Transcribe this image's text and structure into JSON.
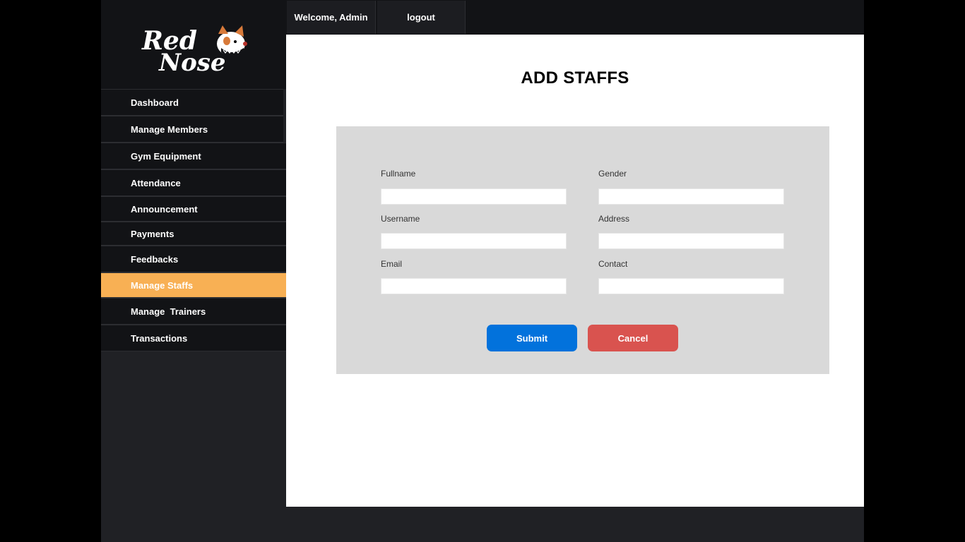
{
  "brand": {
    "logo_line1": "Red",
    "logo_line2": "Nose"
  },
  "topbar": {
    "welcome": "Welcome, Admin",
    "logout": "logout"
  },
  "sidebar": {
    "items": [
      {
        "label": "Dashboard"
      },
      {
        "label": "Manage Members"
      },
      {
        "label": "Gym Equipment"
      },
      {
        "label": "Attendance"
      },
      {
        "label": "Announcement"
      },
      {
        "label": "Payments"
      },
      {
        "label": "Feedbacks"
      },
      {
        "label": "Manage Staffs",
        "active": true
      },
      {
        "label": "Manage  Trainers"
      },
      {
        "label": "Transactions"
      }
    ]
  },
  "page": {
    "title": "ADD STAFFS"
  },
  "form": {
    "fullname": {
      "label": "Fullname",
      "value": ""
    },
    "gender": {
      "label": "Gender",
      "value": ""
    },
    "username": {
      "label": "Username",
      "value": ""
    },
    "address": {
      "label": "Address",
      "value": ""
    },
    "email": {
      "label": "Email",
      "value": ""
    },
    "contact": {
      "label": "Contact",
      "value": ""
    },
    "submit_label": "Submit",
    "cancel_label": "Cancel"
  },
  "colors": {
    "active_menu": "#f8b054",
    "submit": "#0272dc",
    "cancel": "#d9534f",
    "panel": "#d9d9d9"
  }
}
